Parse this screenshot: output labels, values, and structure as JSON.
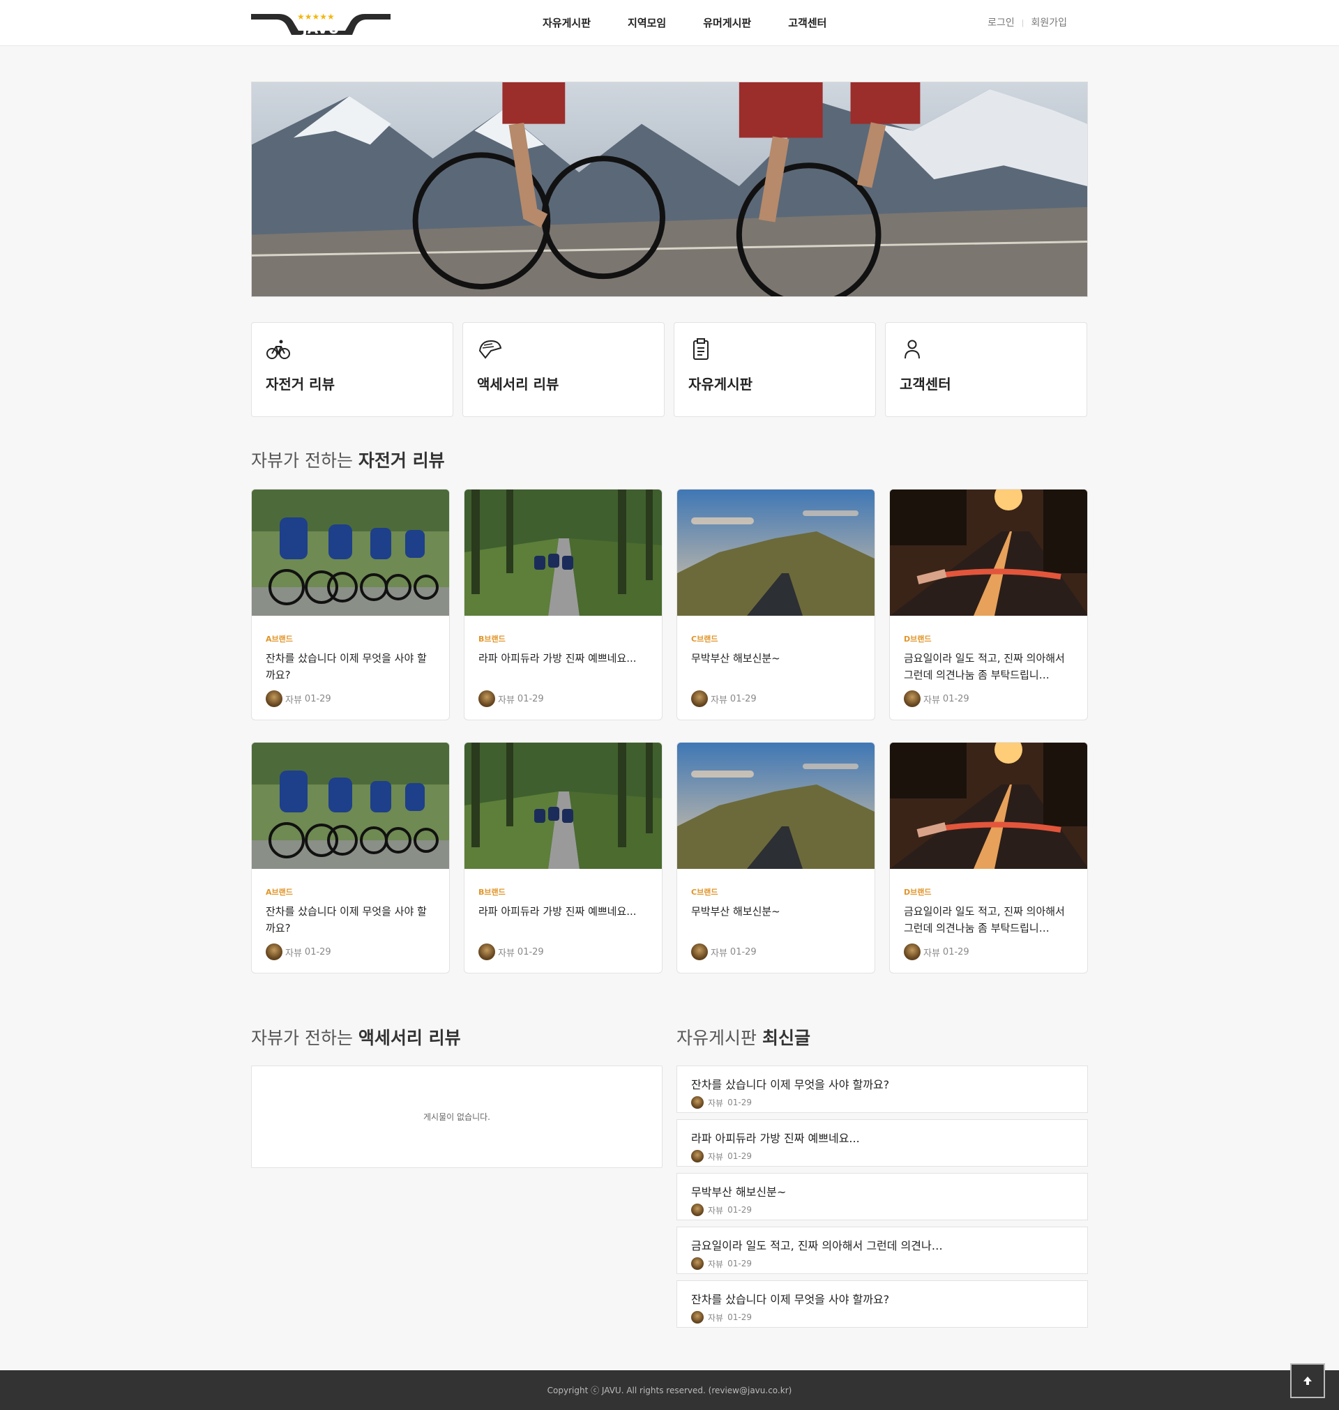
{
  "header": {
    "logo_text": "JAVU",
    "nav": [
      "자유게시판",
      "지역모임",
      "유머게시판",
      "고객센터"
    ],
    "login": "로그인",
    "separator": "|",
    "signup": "회원가입"
  },
  "quick_menu": [
    {
      "label": "자전거 리뷰",
      "icon": "bicycle-icon"
    },
    {
      "label": "액세서리 리뷰",
      "icon": "helmet-icon"
    },
    {
      "label": "자유게시판",
      "icon": "clipboard-icon"
    },
    {
      "label": "고객센터",
      "icon": "person-icon"
    }
  ],
  "bike_review": {
    "title_prefix": "자뷰가 전하는 ",
    "title_bold": "자전거 리뷰",
    "rows": [
      [
        {
          "brand": "A브랜드",
          "title": "잔차를 샀습니다 이제 무엇을 사야 할까요?",
          "author": "자뷰",
          "date": "01-29"
        },
        {
          "brand": "B브랜드",
          "title": "라파 아피듀라 가방 진짜 예쁘네요...",
          "author": "자뷰",
          "date": "01-29"
        },
        {
          "brand": "C브랜드",
          "title": "무박부산 해보신분~",
          "author": "자뷰",
          "date": "01-29"
        },
        {
          "brand": "D브랜드",
          "title": "금요일이라 일도 적고, 진짜 의아해서 그런데 의견나눔 좀 부탁드립니…",
          "author": "자뷰",
          "date": "01-29"
        }
      ],
      [
        {
          "brand": "A브랜드",
          "title": "잔차를 샀습니다 이제 무엇을 사야 할까요?",
          "author": "자뷰",
          "date": "01-29"
        },
        {
          "brand": "B브랜드",
          "title": "라파 아피듀라 가방 진짜 예쁘네요...",
          "author": "자뷰",
          "date": "01-29"
        },
        {
          "brand": "C브랜드",
          "title": "무박부산 해보신분~",
          "author": "자뷰",
          "date": "01-29"
        },
        {
          "brand": "D브랜드",
          "title": "금요일이라 일도 적고, 진짜 의아해서 그런데 의견나눔 좀 부탁드립니…",
          "author": "자뷰",
          "date": "01-29"
        }
      ]
    ]
  },
  "accessory_review": {
    "title_prefix": "자뷰가 전하는 ",
    "title_bold": "액세서리 리뷰",
    "empty_text": "게시물이 없습니다."
  },
  "free_board": {
    "title_prefix": "자유게시판 ",
    "title_bold": "최신글",
    "items": [
      {
        "title": "잔차를 샀습니다 이제 무엇을 사야 할까요?",
        "author": "자뷰",
        "date": "01-29"
      },
      {
        "title": "라파 아피듀라 가방 진짜 예쁘네요...",
        "author": "자뷰",
        "date": "01-29"
      },
      {
        "title": "무박부산 해보신분~",
        "author": "자뷰",
        "date": "01-29"
      },
      {
        "title": "금요일이라 일도 적고, 진짜 의아해서 그런데 의견나눔 …",
        "author": "자뷰",
        "date": "01-29"
      },
      {
        "title": "잔차를 샀습니다 이제 무엇을 사야 할까요?",
        "author": "자뷰",
        "date": "01-29"
      }
    ]
  },
  "footer": {
    "copyright": "Copyright ⓒ JAVU. All rights reserved. (review@javu.co.kr)"
  },
  "colors": {
    "brand_accent": "#e0952a",
    "footer_bg": "#333333",
    "star": "#f2b713"
  }
}
